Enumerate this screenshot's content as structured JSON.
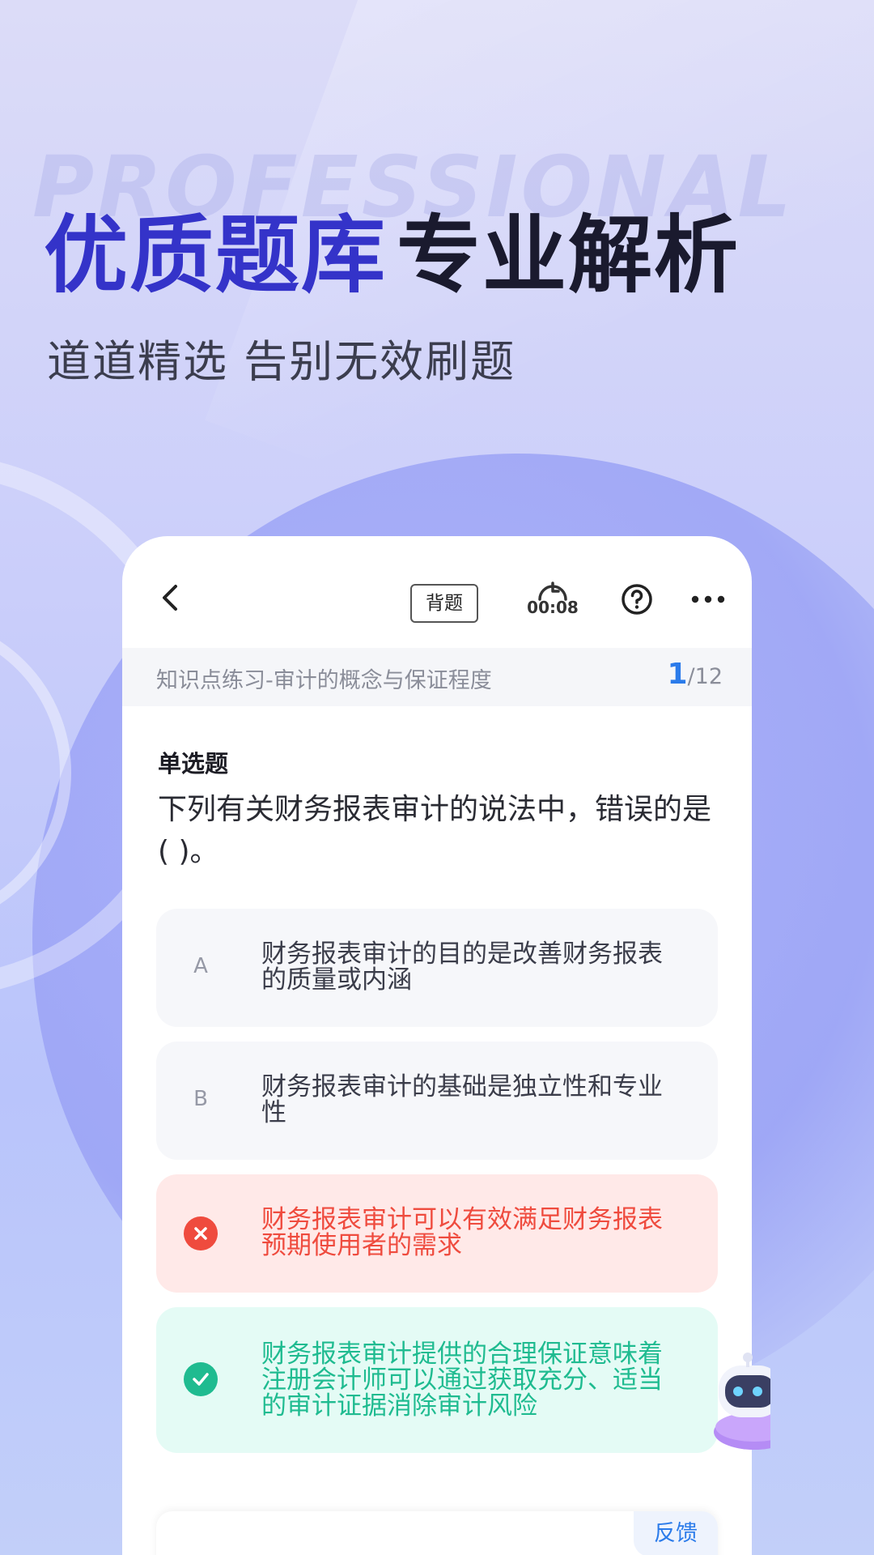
{
  "promo": {
    "watermark": "PROFESSIONAL",
    "headline_accent": "优质题库",
    "headline_rest": "专业解析",
    "subline": "道道精选 告别无效刷题"
  },
  "toolbar": {
    "memorize_label": "背题",
    "timer": "00:08"
  },
  "breadcrumb": {
    "title": "知识点练习-审计的概念与保证程度",
    "current": "1",
    "total": "/12"
  },
  "question": {
    "type": "单选题",
    "text": "下列有关财务报表审计的说法中，错误的是( )。"
  },
  "options": [
    {
      "letter": "A",
      "text": "财务报表审计的目的是改善财务报表的质量或内涵",
      "state": "normal"
    },
    {
      "letter": "B",
      "text": "财务报表审计的基础是独立性和专业性",
      "state": "normal"
    },
    {
      "letter": "",
      "text": "财务报表审计可以有效满足财务报表预期使用者的需求",
      "state": "wrong"
    },
    {
      "letter": "",
      "text": "财务报表审计提供的合理保证意味着注册会计师可以通过获取充分、适当的审计证据消除审计风险",
      "state": "correct"
    }
  ],
  "feedback_label": "反馈",
  "colors": {
    "accent": "#3433c9",
    "brand_blue": "#2b7bea",
    "wrong": "#ef4b3e",
    "correct": "#1fbb90"
  }
}
